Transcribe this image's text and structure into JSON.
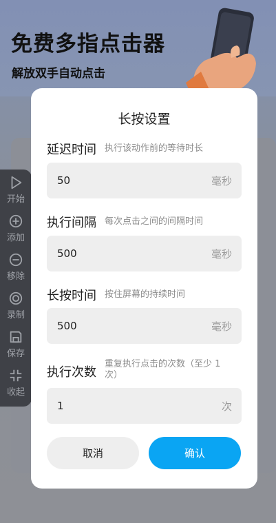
{
  "background": {
    "title": "免费多指点击器",
    "subtitle": "解放双手自动点击"
  },
  "toolbar": {
    "items": [
      {
        "label": "开始",
        "icon": "play-icon"
      },
      {
        "label": "添加",
        "icon": "plus-circle-icon"
      },
      {
        "label": "移除",
        "icon": "minus-circle-icon"
      },
      {
        "label": "录制",
        "icon": "record-icon"
      },
      {
        "label": "保存",
        "icon": "save-icon"
      },
      {
        "label": "收起",
        "icon": "collapse-icon"
      }
    ]
  },
  "dialog": {
    "title": "长按设置",
    "fields": [
      {
        "label": "延迟时间",
        "hint": "执行该动作前的等待时长",
        "value": "50",
        "unit": "毫秒"
      },
      {
        "label": "执行间隔",
        "hint": "每次点击之间的间隔时间",
        "value": "500",
        "unit": "毫秒"
      },
      {
        "label": "长按时间",
        "hint": "按住屏幕的持续时间",
        "value": "500",
        "unit": "毫秒"
      },
      {
        "label": "执行次数",
        "hint_line1": "重复执行点击的次数（至少 1",
        "hint_line2": "次）",
        "value": "1",
        "unit": "次"
      }
    ],
    "cancel_label": "取消",
    "confirm_label": "确认"
  },
  "colors": {
    "accent": "#0aa5f3",
    "toolbar_bg": "#3f4147",
    "input_bg": "#eeeeee"
  }
}
